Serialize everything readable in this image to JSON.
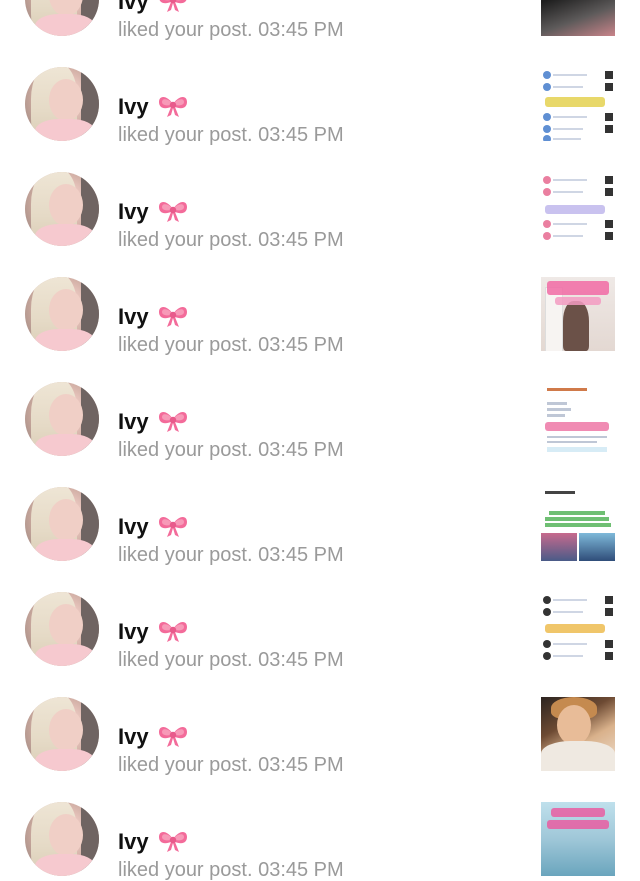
{
  "notifications": [
    {
      "name": "Ivy",
      "text": "liked your post. 03:45 PM",
      "thumb": "t-dark"
    },
    {
      "name": "Ivy",
      "text": "liked your post. 03:45 PM",
      "thumb": "t-list-blue"
    },
    {
      "name": "Ivy",
      "text": "liked your post. 03:45 PM",
      "thumb": "t-list-pink"
    },
    {
      "name": "Ivy",
      "text": "liked your post. 03:45 PM",
      "thumb": "t-room"
    },
    {
      "name": "Ivy",
      "text": "liked your post. 03:45 PM",
      "thumb": "t-doc"
    },
    {
      "name": "Ivy",
      "text": "liked your post. 03:45 PM",
      "thumb": "t-quote"
    },
    {
      "name": "Ivy",
      "text": "liked your post. 03:45 PM",
      "thumb": "t-list-mixed"
    },
    {
      "name": "Ivy",
      "text": "liked your post. 03:45 PM",
      "thumb": "t-portrait"
    },
    {
      "name": "Ivy",
      "text": "liked your post. 03:45 PM",
      "thumb": "t-aqua"
    }
  ],
  "icons": {
    "bow": "pink-ribbon-bow-icon"
  },
  "colors": {
    "name": "#111111",
    "secondary_text": "#9a9a9a",
    "bow": "#f36b9a",
    "background": "#ffffff"
  }
}
